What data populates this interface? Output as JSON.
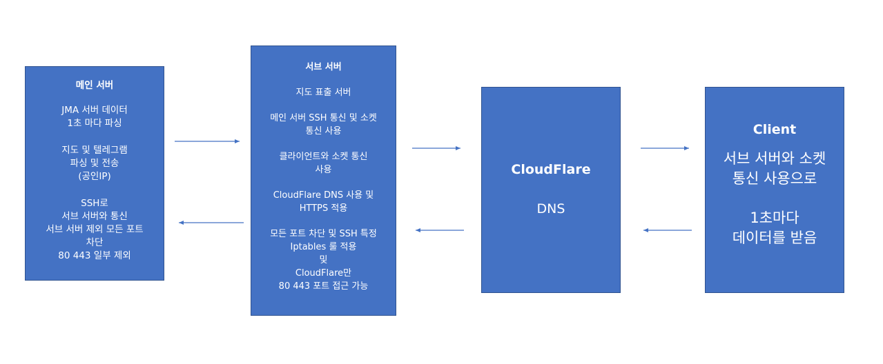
{
  "main_server": {
    "title": "메인 서버",
    "lines": [
      [
        "JMA 서버 데이터",
        "1초 마다 파싱"
      ],
      [
        "지도 및 텔레그램",
        "파싱 및 전송",
        "(공인IP)"
      ],
      [
        "SSH로",
        "서브 서버와 통신",
        "서브 서버 제외 모든 포트",
        "차단",
        "80 443 일부 제외"
      ]
    ]
  },
  "sub_server": {
    "title": "서브 서버",
    "lines": [
      [
        "지도 표출 서버"
      ],
      [
        "메인 서버 SSH 통신 및 소켓",
        "통신 사용"
      ],
      [
        "클라이언트와 소켓 통신",
        "사용"
      ],
      [
        "CloudFlare DNS 사용 및",
        "HTTPS 적용"
      ],
      [
        "모든 포트 차단 및 SSH 특정",
        "Iptables 룰 적용",
        "및",
        "CloudFlare만",
        "80 443 포트 접근 가능"
      ]
    ]
  },
  "cloudflare": {
    "title": "CloudFlare",
    "subtitle": "DNS"
  },
  "client": {
    "title": "Client",
    "lines": [
      [
        "서브 서버와 소켓",
        "통신 사용으로"
      ],
      [
        "1초마다",
        "데이터를 받음"
      ]
    ]
  },
  "colors": {
    "box_fill": "#4472c4",
    "box_border": "#2f528f",
    "text": "#ffffff",
    "arrow": "#4472c4"
  }
}
